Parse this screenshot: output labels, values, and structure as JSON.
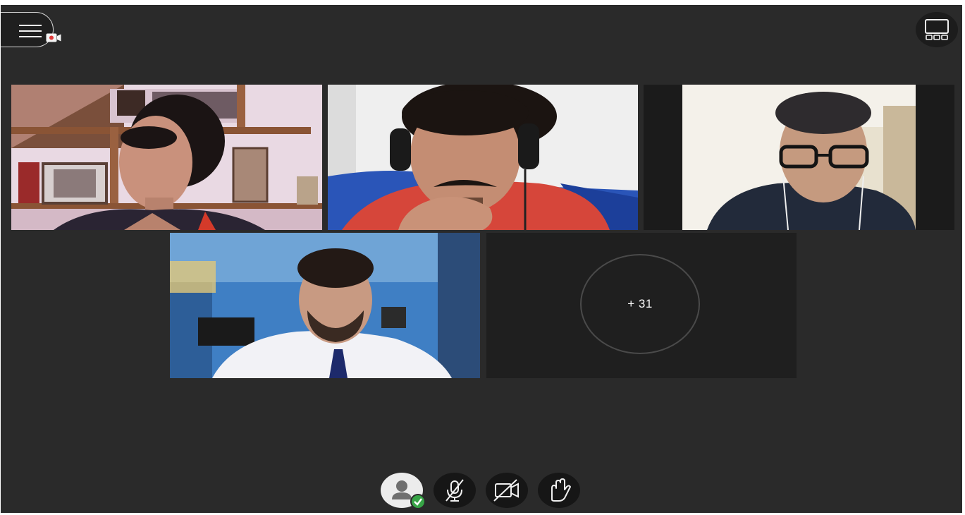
{
  "app": {
    "more_participants_label": "+ 31",
    "accent_recording": "#e03a3a",
    "status_available_color": "#37a446"
  },
  "top_bar": {
    "menu_icon": "hamburger-icon",
    "recording_icon": "recording-camera-icon",
    "layout_icon": "gallery-layout-icon"
  },
  "controls": [
    {
      "name": "my-status",
      "icon": "person-icon",
      "state": "available"
    },
    {
      "name": "microphone",
      "icon": "microphone-off-icon",
      "state": "off"
    },
    {
      "name": "camera",
      "icon": "camera-off-icon",
      "state": "off"
    },
    {
      "name": "raise-hand",
      "icon": "hand-icon",
      "state": "lowered"
    }
  ]
}
